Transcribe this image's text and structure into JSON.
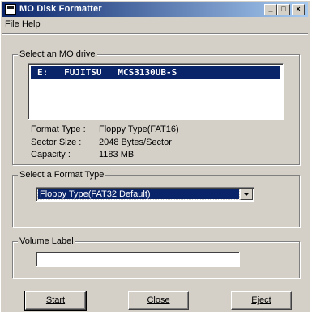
{
  "window": {
    "title": "MO Disk Formatter",
    "controls": {
      "minimize": "_",
      "maximize": "□",
      "close": "×"
    }
  },
  "menu": {
    "file": "File",
    "help": "Help"
  },
  "drive_group": {
    "label": "Select an MO drive",
    "selected_drive": "E:   FUJITSU   MCS3130UB-S"
  },
  "info": {
    "format_type_label": "Format Type :",
    "format_type_value": "Floppy Type(FAT16)",
    "sector_size_label": "Sector Size :",
    "sector_size_value": "2048 Bytes/Sector",
    "capacity_label": "Capacity :",
    "capacity_value": "1183 MB"
  },
  "format_group": {
    "label": "Select a Format Type",
    "selected": "Floppy Type(FAT32 Default)"
  },
  "volume_group": {
    "label": "Volume Label",
    "value": ""
  },
  "buttons": {
    "start": "Start",
    "close": "Close",
    "eject": "Eject"
  }
}
